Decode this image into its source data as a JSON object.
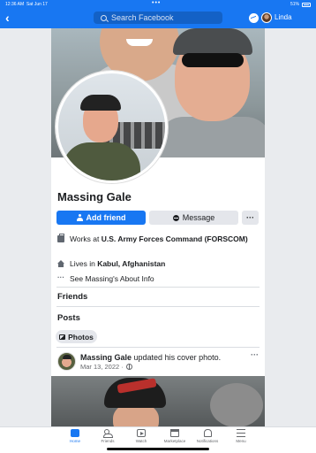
{
  "status_bar": {
    "time": "12:36 AM",
    "date": "Sat Jun 17",
    "battery": "51%"
  },
  "header": {
    "back_label": "‹",
    "search_placeholder": "Search Facebook",
    "user_name": "Linda",
    "icons": [
      "back-icon",
      "search-icon",
      "messenger-icon"
    ]
  },
  "profile": {
    "name": "Massing Gale",
    "add_friend_label": "Add friend",
    "message_label": "Message",
    "more_label": "···",
    "info": {
      "works_prefix": "Works at ",
      "works_at": "U.S. Army Forces Command (FORSCOM)",
      "lives_prefix": "Lives in ",
      "lives_in": "Kabul, Afghanistan",
      "about_link": "See Massing's About Info"
    }
  },
  "sections": {
    "friends_title": "Friends",
    "posts_title": "Posts",
    "photos_chip": "Photos"
  },
  "post": {
    "author": "Massing Gale",
    "action": " updated his cover photo.",
    "date": "Mar 13, 2022 ·",
    "menu_label": "···"
  },
  "tabbar": {
    "items": [
      {
        "label": "Home",
        "icon": "home-icon",
        "active": true
      },
      {
        "label": "Friends",
        "icon": "friends-icon",
        "active": false
      },
      {
        "label": "Watch",
        "icon": "watch-icon",
        "active": false
      },
      {
        "label": "Marketplace",
        "icon": "marketplace-icon",
        "active": false
      },
      {
        "label": "Notifications",
        "icon": "bell-icon",
        "active": false
      },
      {
        "label": "Menu",
        "icon": "menu-icon",
        "active": false
      }
    ]
  },
  "colors": {
    "brand": "#1877f2",
    "button_secondary": "#e4e6eb",
    "text_primary": "#1c1e21",
    "text_secondary": "#65676b"
  }
}
